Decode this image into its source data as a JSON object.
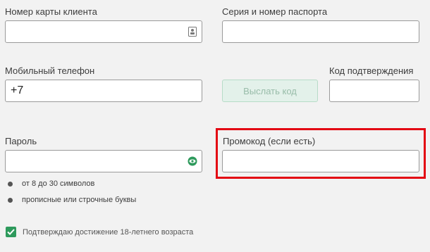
{
  "form": {
    "card_number": {
      "label": "Номер карты клиента",
      "value": "",
      "icon": "id-card-icon"
    },
    "passport": {
      "label": "Серия и номер паспорта",
      "value": ""
    },
    "phone": {
      "label": "Мобильный телефон",
      "value": "+7"
    },
    "send_code_button": "Выслать код",
    "confirmation_code": {
      "label": "Код подтверждения",
      "value": ""
    },
    "password": {
      "label": "Пароль",
      "value": "",
      "icon": "eye-icon"
    },
    "promo_code": {
      "label": "Промокод (если есть)",
      "value": ""
    },
    "password_rules": [
      "от 8 до 30 символов",
      "прописные или строчные буквы"
    ],
    "age_confirmation": {
      "label": "Подтверждаю достижение 18-летнего возраста",
      "checked": true
    }
  },
  "colors": {
    "accent": "#2e9a5c",
    "highlight": "#e30613",
    "button_bg": "#e3f1ea",
    "button_text": "#98bca9"
  }
}
